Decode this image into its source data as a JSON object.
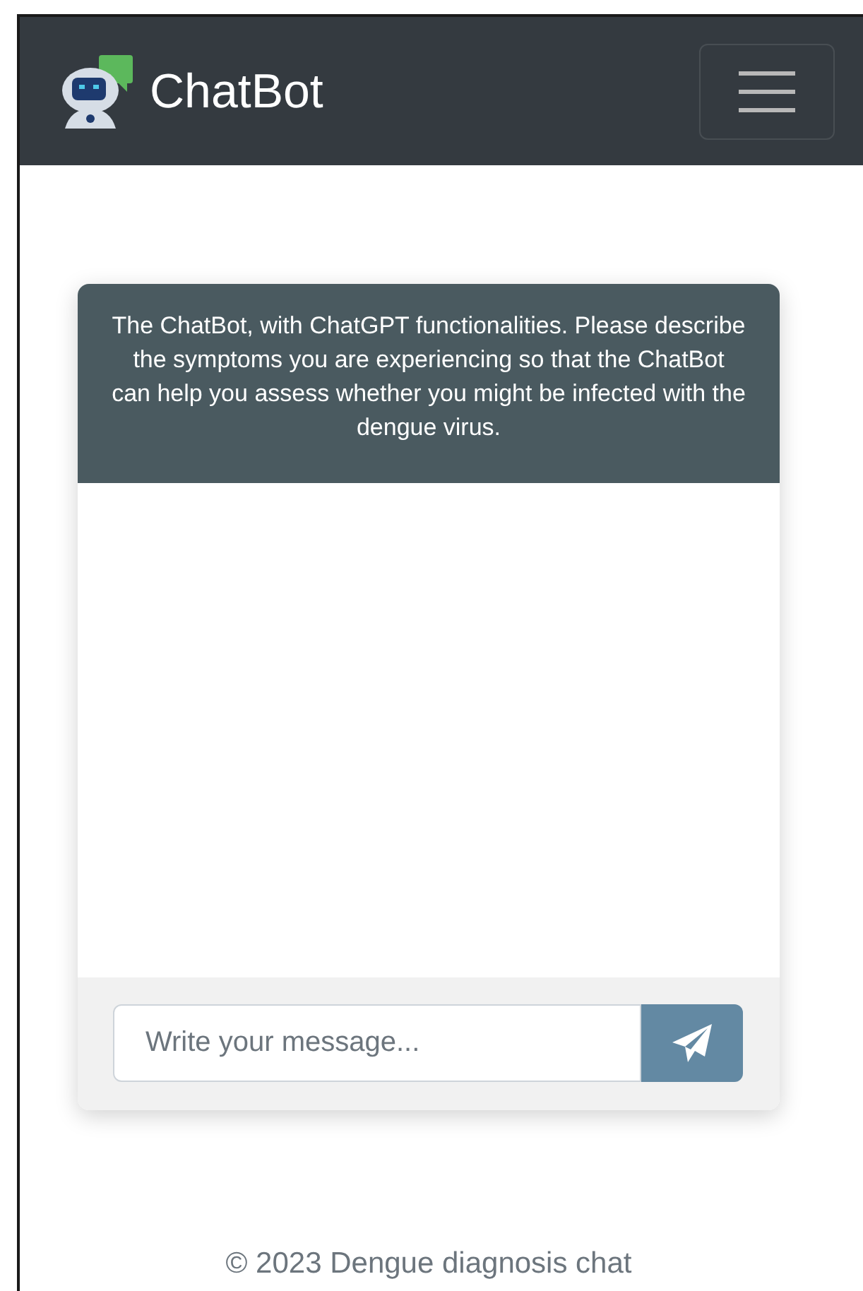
{
  "navbar": {
    "brand": "ChatBot"
  },
  "chat": {
    "intro": "The ChatBot, with ChatGPT functionalities. Please describe the symptoms you are experiencing so that the ChatBot can help you assess whether you might be infected with the dengue virus.",
    "input": {
      "placeholder": "Write your message..."
    }
  },
  "footer": {
    "text": "© 2023 Dengue diagnosis chat"
  }
}
